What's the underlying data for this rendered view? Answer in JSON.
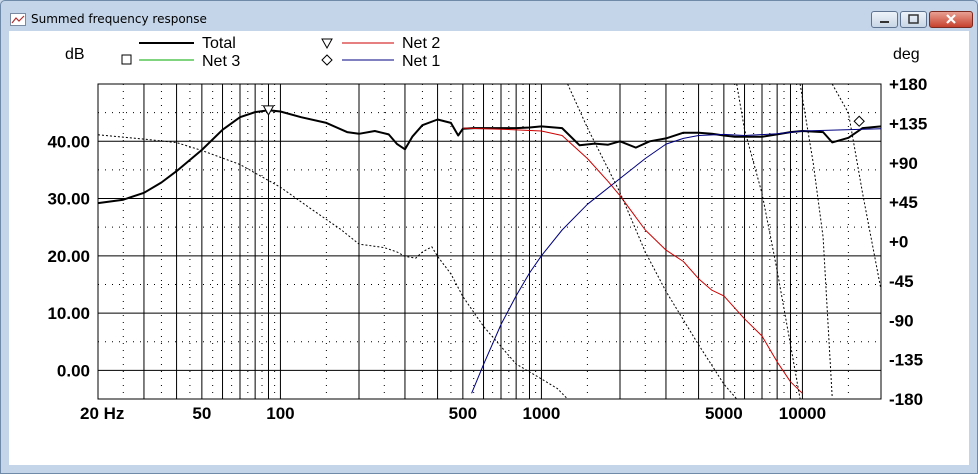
{
  "window": {
    "title": "Summed frequency response",
    "icon": "graph-window-icon",
    "buttons": [
      "minimize-icon",
      "maximize-icon",
      "close-icon"
    ]
  },
  "chart_data": {
    "type": "line",
    "xscale": "log",
    "xlim": [
      20,
      20000
    ],
    "ylim": [
      -5,
      50
    ],
    "y2lim": [
      -180,
      180
    ],
    "xticks_labeled": [
      {
        "value": 20,
        "label": "20 Hz"
      },
      {
        "value": 50,
        "label": "50"
      },
      {
        "value": 100,
        "label": "100"
      },
      {
        "value": 500,
        "label": "500"
      },
      {
        "value": 1000,
        "label": "1000"
      },
      {
        "value": 5000,
        "label": "5000"
      },
      {
        "value": 10000,
        "label": "10000"
      }
    ],
    "yticks": [
      {
        "value": 0,
        "label": "0.00"
      },
      {
        "value": 10,
        "label": "10.00"
      },
      {
        "value": 20,
        "label": "20.00"
      },
      {
        "value": 30,
        "label": "30.00"
      },
      {
        "value": 40,
        "label": "40.00"
      }
    ],
    "y2ticks": [
      {
        "value": 180,
        "label": "+180"
      },
      {
        "value": 135,
        "label": "+135"
      },
      {
        "value": 90,
        "label": "+90"
      },
      {
        "value": 45,
        "label": "+45"
      },
      {
        "value": 0,
        "label": "+0"
      },
      {
        "value": -45,
        "label": "-45"
      },
      {
        "value": -90,
        "label": "-90"
      },
      {
        "value": -135,
        "label": "-135"
      },
      {
        "value": -180,
        "label": "-180"
      }
    ],
    "ylabel": "dB",
    "y2label": "deg",
    "grid": true,
    "legend_position": "top",
    "legend": [
      {
        "name": "Total",
        "color": "#000000",
        "marker": "",
        "bold": true
      },
      {
        "name": "Net 2",
        "color": "#cc0000",
        "marker": "triangle-down"
      },
      {
        "name": "Net 3",
        "color": "#00aa00",
        "marker": "square"
      },
      {
        "name": "Net 1",
        "color": "#000080",
        "marker": "diamond"
      }
    ],
    "series": [
      {
        "name": "Total",
        "color": "#000000",
        "axis": "left",
        "style": "thick",
        "x": [
          20,
          25,
          30,
          35,
          40,
          50,
          60,
          70,
          80,
          90,
          100,
          120,
          150,
          180,
          200,
          230,
          260,
          280,
          300,
          320,
          350,
          400,
          450,
          480,
          500,
          550,
          600,
          650,
          700,
          800,
          900,
          1000,
          1200,
          1400,
          1600,
          1800,
          2000,
          2300,
          2600,
          3000,
          3500,
          4000,
          4500,
          5000,
          5500,
          6000,
          7000,
          8000,
          9000,
          10000,
          12000,
          13000,
          15000,
          17000,
          20000
        ],
        "y": [
          29.2,
          29.8,
          31.0,
          32.8,
          34.8,
          38.5,
          42.0,
          44.2,
          45.1,
          45.4,
          45.2,
          44.2,
          43.2,
          41.6,
          41.3,
          41.8,
          41.2,
          39.5,
          38.6,
          40.8,
          42.8,
          43.8,
          43.2,
          41.0,
          42.2,
          42.3,
          42.3,
          42.3,
          42.3,
          42.3,
          42.4,
          42.6,
          42.3,
          39.3,
          39.6,
          39.4,
          40.0,
          38.9,
          40.0,
          40.5,
          41.5,
          41.5,
          41.3,
          41.0,
          40.8,
          40.8,
          40.8,
          41.2,
          41.6,
          41.8,
          41.6,
          39.8,
          40.6,
          42.3,
          42.6
        ]
      },
      {
        "name": "Net 2",
        "color": "#cc0000",
        "axis": "left",
        "style": "thin",
        "x": [
          500,
          700,
          1000,
          1200,
          1500,
          1800,
          2000,
          2500,
          3000,
          3500,
          4000,
          4500,
          5000,
          6000,
          7000,
          8000,
          9000,
          10000
        ],
        "y": [
          42.3,
          42.1,
          41.8,
          41.0,
          37.0,
          33.0,
          30.5,
          24.5,
          21.0,
          19.0,
          16.0,
          14.0,
          13.0,
          9.0,
          6.0,
          1.5,
          -2.0,
          -4.0
        ]
      },
      {
        "name": "Net 3",
        "color": "#00aa00",
        "axis": "left",
        "style": "thin",
        "x": [],
        "y": []
      },
      {
        "name": "Net 1",
        "color": "#000080",
        "axis": "left",
        "style": "thin",
        "x": [
          540,
          600,
          700,
          800,
          900,
          1000,
          1200,
          1500,
          2000,
          2500,
          3000,
          3500,
          4000,
          5000,
          6000,
          8000,
          10000,
          20000
        ],
        "y": [
          -4.0,
          1.0,
          8.0,
          13.0,
          17.0,
          20.0,
          24.5,
          29.0,
          33.5,
          37.0,
          39.5,
          40.5,
          41.0,
          41.2,
          41.0,
          41.3,
          41.8,
          42.2
        ]
      },
      {
        "name": "Total phase",
        "color": "#000000",
        "axis": "right",
        "style": "dotted",
        "x": [
          20,
          30,
          40,
          50,
          70,
          100,
          130,
          170,
          200,
          250,
          280,
          300,
          330,
          350,
          380,
          400,
          450,
          500,
          600,
          700,
          800,
          1000,
          1150,
          1260,
          1260,
          1500,
          2000,
          2500,
          3000,
          4000,
          5000,
          5600,
          5600,
          6000,
          7000,
          8000,
          9000,
          9800,
          9800,
          11000,
          12000,
          13000,
          13000,
          15000,
          17000,
          20000
        ],
        "y": [
          122,
          117,
          113,
          104,
          88,
          62,
          38,
          14,
          -3,
          -7,
          -12,
          -17,
          -19,
          -12,
          -6,
          -17,
          -37,
          -63,
          -97,
          -120,
          -140,
          -157,
          -168,
          -180,
          180,
          130,
          56,
          -12,
          -57,
          -118,
          -163,
          -180,
          180,
          128,
          55,
          -33,
          -118,
          -180,
          180,
          90,
          5,
          -178,
          180,
          147,
          55,
          -55
        ]
      }
    ],
    "markers": [
      {
        "series": "Net 2",
        "shape": "triangle-down",
        "x": 90,
        "y": 45.3
      },
      {
        "series": "Net 1",
        "shape": "diamond",
        "x": 16500,
        "y": 43.5
      }
    ]
  }
}
